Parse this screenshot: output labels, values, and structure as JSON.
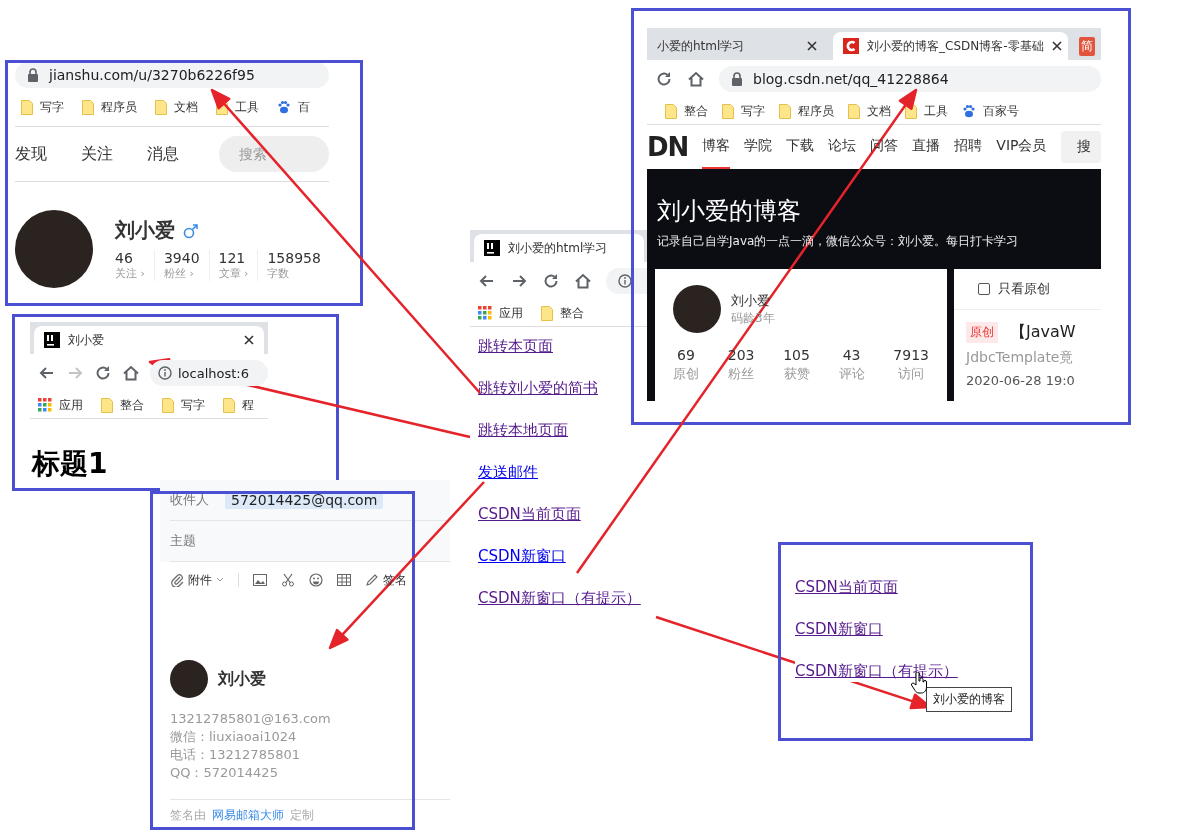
{
  "jianshu_panel": {
    "address": "jianshu.com/u/3270b6226f95",
    "bookmarks": [
      {
        "label": "写字",
        "kind": "folder"
      },
      {
        "label": "程序员",
        "kind": "folder"
      },
      {
        "label": "文档",
        "kind": "folder"
      },
      {
        "label": "工具",
        "kind": "folder"
      },
      {
        "label": "百",
        "kind": "baidu"
      }
    ],
    "nav": [
      {
        "label": "发现"
      },
      {
        "label": "关注"
      },
      {
        "label": "消息"
      }
    ],
    "search": {
      "placeholder": "搜索"
    },
    "profile": {
      "name": "刘小爱",
      "stats": [
        {
          "value": "46",
          "label": "关注 ›"
        },
        {
          "value": "3940",
          "label": "粉丝 ›"
        },
        {
          "value": "121",
          "label": "文章 ›"
        },
        {
          "value": "158958",
          "label": "字数"
        }
      ]
    }
  },
  "local_panel": {
    "tab": {
      "title": "刘小爱"
    },
    "nav_buttons": [
      {
        "kind": "back",
        "disabled": false
      },
      {
        "kind": "forward",
        "disabled": true
      },
      {
        "kind": "reload",
        "disabled": false
      },
      {
        "kind": "home",
        "disabled": false
      }
    ],
    "address": "localhost:6",
    "bookmarks": [
      {
        "label": "应用",
        "kind": "apps"
      },
      {
        "label": "整合",
        "kind": "folder"
      },
      {
        "label": "写字",
        "kind": "folder"
      },
      {
        "label": "程",
        "kind": "folder"
      }
    ],
    "heading": "标题1"
  },
  "mail_panel": {
    "recipient_label": "收件人",
    "recipient": "572014425@qq.com",
    "subject_label": "主题",
    "toolbar": [
      {
        "kind": "attach",
        "label": "附件"
      },
      {
        "kind": "image"
      },
      {
        "kind": "scissors"
      },
      {
        "kind": "emoji"
      },
      {
        "kind": "table"
      },
      {
        "kind": "signature",
        "label": "签名"
      }
    ],
    "signature": {
      "name": "刘小爱",
      "lines": [
        "13212785801@163.com",
        "微信：liuxiaoai1024",
        "电话：13212785801",
        "QQ：572014425"
      ]
    },
    "footer": {
      "prefix": "签名由",
      "link": "网易邮箱大师",
      "suffix": "定制"
    }
  },
  "demo_page": {
    "tab": {
      "title": "刘小爱的html学习"
    },
    "nav_buttons": [
      {
        "kind": "back",
        "disabled": false
      },
      {
        "kind": "forward",
        "disabled": false
      },
      {
        "kind": "reload",
        "disabled": false
      },
      {
        "kind": "home",
        "disabled": false
      }
    ],
    "bookmarks": [
      {
        "label": "应用",
        "kind": "apps"
      },
      {
        "label": "整合",
        "kind": "folder"
      }
    ],
    "links": [
      {
        "label": "跳转本页面",
        "visited": true
      },
      {
        "label": "跳转刘小爱的简书",
        "visited": true
      },
      {
        "label": "跳转本地页面",
        "visited": true
      },
      {
        "label": "发送邮件",
        "visited": false
      },
      {
        "label": "CSDN当前页面",
        "visited": true
      },
      {
        "label": "CSDN新窗口",
        "visited": false
      },
      {
        "label": "CSDN新窗口（有提示）",
        "visited": true
      }
    ]
  },
  "csdn_panel": {
    "tabs": [
      {
        "title": "小爱的html学习",
        "kind": "page",
        "selected": false
      },
      {
        "title": "刘小爱的博客_CSDN博客-零基础",
        "kind": "csdn",
        "selected": true
      },
      {
        "title": "简",
        "kind": "badge",
        "selected": false
      }
    ],
    "address": "blog.csdn.net/qq_41228864",
    "bookmarks": [
      {
        "label": "整合",
        "kind": "folder"
      },
      {
        "label": "写字",
        "kind": "folder"
      },
      {
        "label": "程序员",
        "kind": "folder"
      },
      {
        "label": "文档",
        "kind": "folder"
      },
      {
        "label": "工具",
        "kind": "folder"
      },
      {
        "label": "百家号",
        "kind": "baidu"
      }
    ],
    "logo": "DN",
    "nav": [
      {
        "label": "博客",
        "selected": true
      },
      {
        "label": "学院",
        "selected": false
      },
      {
        "label": "下载",
        "selected": false
      },
      {
        "label": "论坛",
        "selected": false
      },
      {
        "label": "问答",
        "selected": false
      },
      {
        "label": "直播",
        "selected": false
      },
      {
        "label": "招聘",
        "selected": false
      },
      {
        "label": "VIP会员",
        "selected": false
      }
    ],
    "search_label": "搜",
    "banner": {
      "title": "刘小爱的博客",
      "subtitle": "记录自己自学Java的一点一滴，微信公众号：刘小爱。每日打卡学习"
    },
    "profile": {
      "name": "刘小爱",
      "meta": "码龄3年",
      "stats": [
        {
          "value": "69",
          "label": "原创"
        },
        {
          "value": "203",
          "label": "粉丝"
        },
        {
          "value": "105",
          "label": "获赞"
        },
        {
          "value": "43",
          "label": "评论"
        },
        {
          "value": "7913",
          "label": "访问"
        }
      ]
    },
    "filter": {
      "label": "只看原创",
      "checked": false
    },
    "article": {
      "tag": "原创",
      "title": "【JavaW",
      "summary": "JdbcTemplate竟",
      "date": "2020-06-28 19:0"
    }
  },
  "tooltip_demo": {
    "links": [
      {
        "label": "CSDN当前页面",
        "visited": true
      },
      {
        "label": "CSDN新窗口",
        "visited": true
      },
      {
        "label": "CSDN新窗口（有提示）",
        "visited": true
      }
    ],
    "tooltip": "刘小爱的博客"
  }
}
